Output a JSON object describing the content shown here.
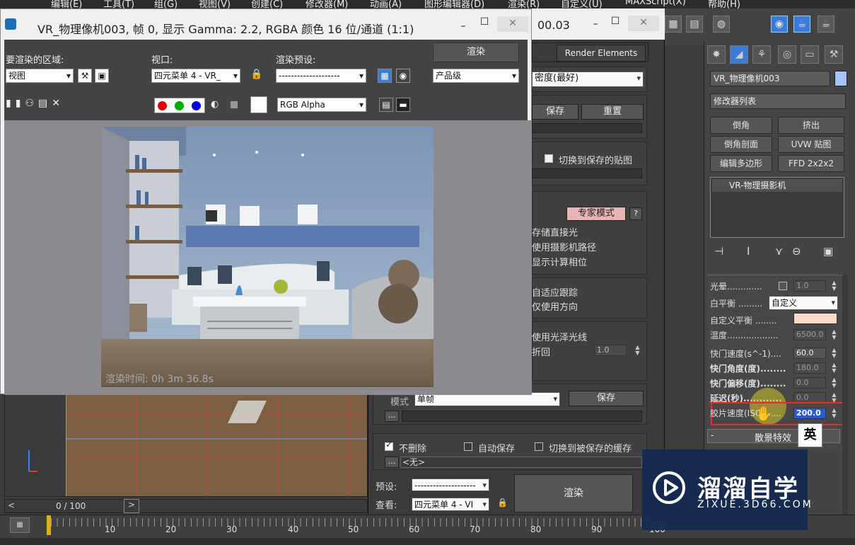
{
  "menubar": {
    "items": [
      "编辑(E)",
      "工具(T)",
      "组(G)",
      "视图(V)",
      "创建(C)",
      "修改器(M)",
      "动画(A)",
      "图形编辑器(D)",
      "渲染(R)",
      "自定义(U)",
      "MAXScript(X)",
      "帮助(H)"
    ]
  },
  "frame_buffer": {
    "title": "VR_物理像机003, 帧 0, 显示 Gamma: 2.2, RGBA 颜色 16 位/通道 (1:1)",
    "minimize": "–",
    "maximize": "☐",
    "close": "✕",
    "area_label": "要渲染的区域:",
    "area_value": "视图",
    "viewport_label": "视口:",
    "viewport_value": "四元菜单 4 - VR_",
    "preset_label": "渲染预设:",
    "preset_value": "--------------------",
    "render_button": "渲染",
    "quality_value": "产品级",
    "channel_value": "RGB Alpha",
    "render_time": "渲染时间: 0h 3m 36.8s"
  },
  "render_setup": {
    "title_suffix": "00.03",
    "tab_render_elements": "Render Elements",
    "density_value": "密度(最好)",
    "save_button": "保存",
    "reset_button": "重置",
    "switch_saved_map": "切换到保存的贴图",
    "expert_mode": "专家模式",
    "help": "?",
    "store_direct": "存储直接光",
    "use_camera_path": "使用摄影机路径",
    "show_calc_phase": "显示计算相位",
    "adaptive_tracking": "自适应跟踪",
    "use_direction_only": "仅使用方向",
    "use_glossy": "使用光泽光线",
    "retrace": "折回",
    "retrace_value": "1.0",
    "mode_label": "模式",
    "mode_value": "单帧",
    "save_button2": "保存",
    "dont_delete": "不删除",
    "auto_save": "自动保存",
    "switch_saved_cache": "切换到被保存的缓存",
    "none_value": "<无>",
    "preset_label": "预设:",
    "preset_value": "--------------------",
    "view_label": "查看:",
    "view_value": "四元菜单 4 - VI",
    "render_button": "渲染"
  },
  "command_panel": {
    "object_name": "VR_物理像机003",
    "modifier_list": "修改器列表",
    "buttons": [
      "倒角",
      "挤出",
      "倒角剖面",
      "UVW 贴图",
      "编辑多边形",
      "FFD 2x2x2"
    ],
    "stack_item": "VR-物理摄影机",
    "params": {
      "vignetting_label": "光晕.............",
      "vignetting_value": "1.0",
      "white_balance_label": "白平衡 .........",
      "white_balance_value": "自定义",
      "custom_wb_label": "自定义平衡 ........",
      "temperature_label": "温度...................",
      "temperature_value": "6500.0",
      "shutter_speed_label": "快门速度(s^-1)....",
      "shutter_speed_value": "60.0",
      "shutter_angle_label": "快门角度(度)........",
      "shutter_angle_value": "180.0",
      "shutter_offset_label": "快门偏移(度)........",
      "shutter_offset_value": "0.0",
      "latency_label": "延迟(秒)............",
      "latency_value": "0.0",
      "iso_label": "胶片速度(ISO)......",
      "iso_value": "200.0",
      "bokeh_label": "散景特效"
    },
    "highlight_color": "#e03030",
    "custom_wb_color": "#ffd8c8"
  },
  "timeline": {
    "frame": "0 / 100",
    "ticks": [
      "10",
      "20",
      "30",
      "40",
      "50",
      "60",
      "70",
      "80",
      "90",
      "100"
    ]
  },
  "ime_indicator": "英",
  "watermark": {
    "brand": "溜溜自学",
    "url": "ZIXUE.3D66.COM"
  },
  "accent": "#3a7bd5"
}
